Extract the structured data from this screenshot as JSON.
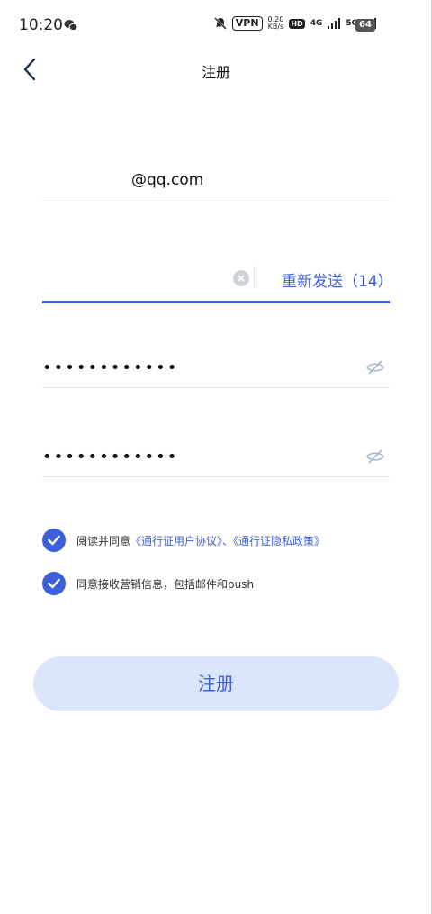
{
  "status_bar": {
    "time": "10:20",
    "vpn": "VPN",
    "speed_value": "0.20",
    "speed_unit": "KB/s",
    "hd": "HD",
    "net1": "4G",
    "net2": "5G",
    "battery": "64"
  },
  "header": {
    "title": "注册"
  },
  "form": {
    "email_value": "@qq.com",
    "resend_label": "重新发送（14）",
    "password_mask": "••••••••••••",
    "confirm_password_mask": "••••••••••••"
  },
  "agreements": {
    "terms_prefix": "阅读并同意",
    "terms_link": "《通行证用户协议》",
    "terms_sep": "、",
    "privacy_link": "《通行证隐私政策》",
    "marketing_text": "同意接收营销信息，包括邮件和push"
  },
  "submit_label": "注册",
  "colors": {
    "accent": "#3d5fd9",
    "button_bg": "#dbe5fc"
  }
}
